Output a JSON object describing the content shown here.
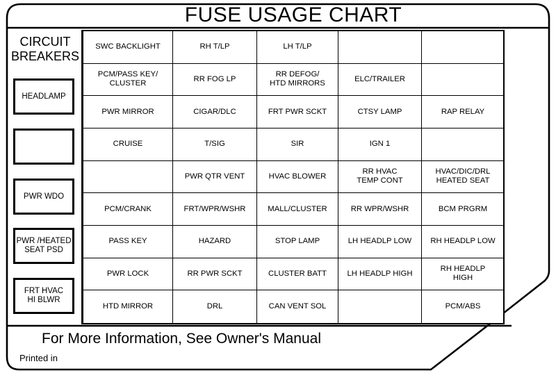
{
  "label": {
    "title": "FUSE USAGE CHART",
    "footer_note": "For More Information, See Owner's Manual",
    "printed_in": "Printed in"
  },
  "circuit_breakers": {
    "heading_line1": "CIRCUIT",
    "heading_line2": "BREAKERS",
    "boxes": [
      {
        "label": "HEADLAMP"
      },
      {
        "label": ""
      },
      {
        "label": "PWR WDO"
      },
      {
        "label": "PWR /HEATED\nSEAT PSD"
      },
      {
        "label": "FRT HVAC\nHI BLWR"
      }
    ]
  },
  "fuse_grid": {
    "columns": 5,
    "rows": 9,
    "cells": [
      [
        "SWC BACKLIGHT",
        "RH T/LP",
        "LH T/LP",
        "",
        ""
      ],
      [
        "PCM/PASS KEY/\nCLUSTER",
        "RR FOG LP",
        "RR DEFOG/\nHTD MIRRORS",
        "ELC/TRAILER",
        ""
      ],
      [
        "PWR MIRROR",
        "CIGAR/DLC",
        "FRT PWR SCKT",
        "CTSY LAMP",
        "RAP RELAY"
      ],
      [
        "CRUISE",
        "T/SIG",
        "SIR",
        "IGN 1",
        ""
      ],
      [
        "",
        "PWR QTR VENT",
        "HVAC BLOWER",
        "RR HVAC\nTEMP CONT",
        "HVAC/DIC/DRL\nHEATED SEAT"
      ],
      [
        "PCM/CRANK",
        "FRT/WPR/WSHR",
        "MALL/CLUSTER",
        "RR WPR/WSHR",
        "BCM PRGRM"
      ],
      [
        "PASS KEY",
        "HAZARD",
        "STOP LAMP",
        "LH HEADLP LOW",
        "RH HEADLP LOW"
      ],
      [
        "PWR LOCK",
        "RR PWR SCKT",
        "CLUSTER BATT",
        "LH HEADLP HIGH",
        "RH HEADLP\nHIGH"
      ],
      [
        "HTD MIRROR",
        "DRL",
        "CAN VENT SOL",
        "",
        "PCM/ABS"
      ]
    ]
  },
  "colors": {
    "ink": "#000000",
    "paper": "#ffffff"
  }
}
